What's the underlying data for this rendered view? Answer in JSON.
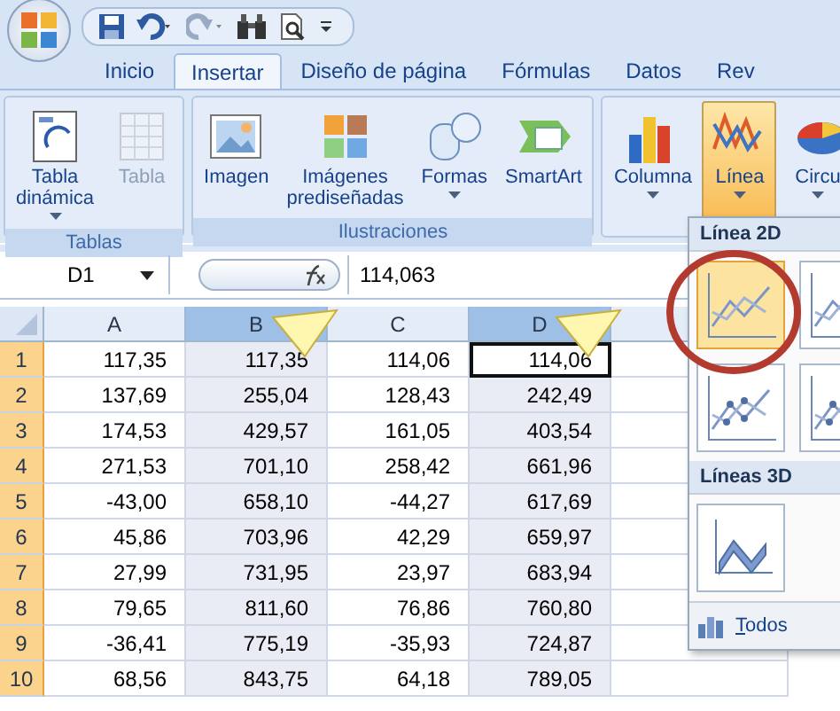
{
  "tabs": [
    {
      "label": "Inicio",
      "selected": false
    },
    {
      "label": "Insertar",
      "selected": true
    },
    {
      "label": "Diseño de página",
      "selected": false
    },
    {
      "label": "Fórmulas",
      "selected": false
    },
    {
      "label": "Datos",
      "selected": false
    },
    {
      "label": "Rev",
      "selected": false
    }
  ],
  "ribbon_groups": [
    {
      "title": "Tablas",
      "buttons": [
        {
          "label": "Tabla dinámica",
          "dropdown": true,
          "disabled": false,
          "selected": false
        },
        {
          "label": "Tabla",
          "dropdown": false,
          "disabled": true,
          "selected": false
        }
      ]
    },
    {
      "title": "Ilustraciones",
      "buttons": [
        {
          "label": "Imagen",
          "dropdown": false,
          "disabled": false,
          "selected": false
        },
        {
          "label": "Imágenes prediseñadas",
          "dropdown": false,
          "disabled": false,
          "selected": false
        },
        {
          "label": "Formas",
          "dropdown": true,
          "disabled": false,
          "selected": false
        },
        {
          "label": "SmartArt",
          "dropdown": false,
          "disabled": false,
          "selected": false
        }
      ]
    },
    {
      "buttons": [
        {
          "label": "Columna",
          "dropdown": true,
          "disabled": false,
          "selected": false
        },
        {
          "label": "Línea",
          "dropdown": true,
          "disabled": false,
          "selected": true
        },
        {
          "label": "Circu",
          "dropdown": true,
          "disabled": false,
          "selected": false
        }
      ]
    }
  ],
  "formula_bar": {
    "name_box": "D1",
    "value": "114,063"
  },
  "table": {
    "columns": [
      {
        "label": "A",
        "selected": false
      },
      {
        "label": "B",
        "selected": true
      },
      {
        "label": "C",
        "selected": false
      },
      {
        "label": "D",
        "selected": true
      }
    ],
    "rows": [
      {
        "num": "1",
        "selected": true,
        "cells": [
          {
            "value": "117,35",
            "active": false
          },
          {
            "value": "117,35",
            "active": false
          },
          {
            "value": "114,06",
            "active": false
          },
          {
            "value": "114,06",
            "active": true
          }
        ]
      },
      {
        "num": "2",
        "selected": true,
        "cells": [
          {
            "value": "137,69",
            "active": false
          },
          {
            "value": "255,04",
            "active": false
          },
          {
            "value": "128,43",
            "active": false
          },
          {
            "value": "242,49",
            "active": false
          }
        ]
      },
      {
        "num": "3",
        "selected": true,
        "cells": [
          {
            "value": "174,53",
            "active": false
          },
          {
            "value": "429,57",
            "active": false
          },
          {
            "value": "161,05",
            "active": false
          },
          {
            "value": "403,54",
            "active": false
          }
        ]
      },
      {
        "num": "4",
        "selected": true,
        "cells": [
          {
            "value": "271,53",
            "active": false
          },
          {
            "value": "701,10",
            "active": false
          },
          {
            "value": "258,42",
            "active": false
          },
          {
            "value": "661,96",
            "active": false
          }
        ]
      },
      {
        "num": "5",
        "selected": true,
        "cells": [
          {
            "value": "-43,00",
            "active": false
          },
          {
            "value": "658,10",
            "active": false
          },
          {
            "value": "-44,27",
            "active": false
          },
          {
            "value": "617,69",
            "active": false
          }
        ]
      },
      {
        "num": "6",
        "selected": true,
        "cells": [
          {
            "value": "45,86",
            "active": false
          },
          {
            "value": "703,96",
            "active": false
          },
          {
            "value": "42,29",
            "active": false
          },
          {
            "value": "659,97",
            "active": false
          }
        ]
      },
      {
        "num": "7",
        "selected": true,
        "cells": [
          {
            "value": "27,99",
            "active": false
          },
          {
            "value": "731,95",
            "active": false
          },
          {
            "value": "23,97",
            "active": false
          },
          {
            "value": "683,94",
            "active": false
          }
        ]
      },
      {
        "num": "8",
        "selected": true,
        "cells": [
          {
            "value": "79,65",
            "active": false
          },
          {
            "value": "811,60",
            "active": false
          },
          {
            "value": "76,86",
            "active": false
          },
          {
            "value": "760,80",
            "active": false
          }
        ]
      },
      {
        "num": "9",
        "selected": true,
        "cells": [
          {
            "value": "-36,41",
            "active": false
          },
          {
            "value": "775,19",
            "active": false
          },
          {
            "value": "-35,93",
            "active": false
          },
          {
            "value": "724,87",
            "active": false
          }
        ]
      },
      {
        "num": "10",
        "selected": true,
        "cells": [
          {
            "value": "68,56",
            "active": false
          },
          {
            "value": "843,75",
            "active": false
          },
          {
            "value": "64,18",
            "active": false
          },
          {
            "value": "789,05",
            "active": false
          }
        ]
      }
    ]
  },
  "gallery": {
    "sections": [
      {
        "title": "Línea 2D",
        "items": [
          {
            "selected": true
          },
          {
            "selected": false
          },
          {
            "selected": false
          },
          {
            "selected": false
          }
        ]
      },
      {
        "title": "Líneas 3D",
        "items": [
          {
            "selected": false
          }
        ]
      }
    ],
    "footer": "Todos"
  }
}
